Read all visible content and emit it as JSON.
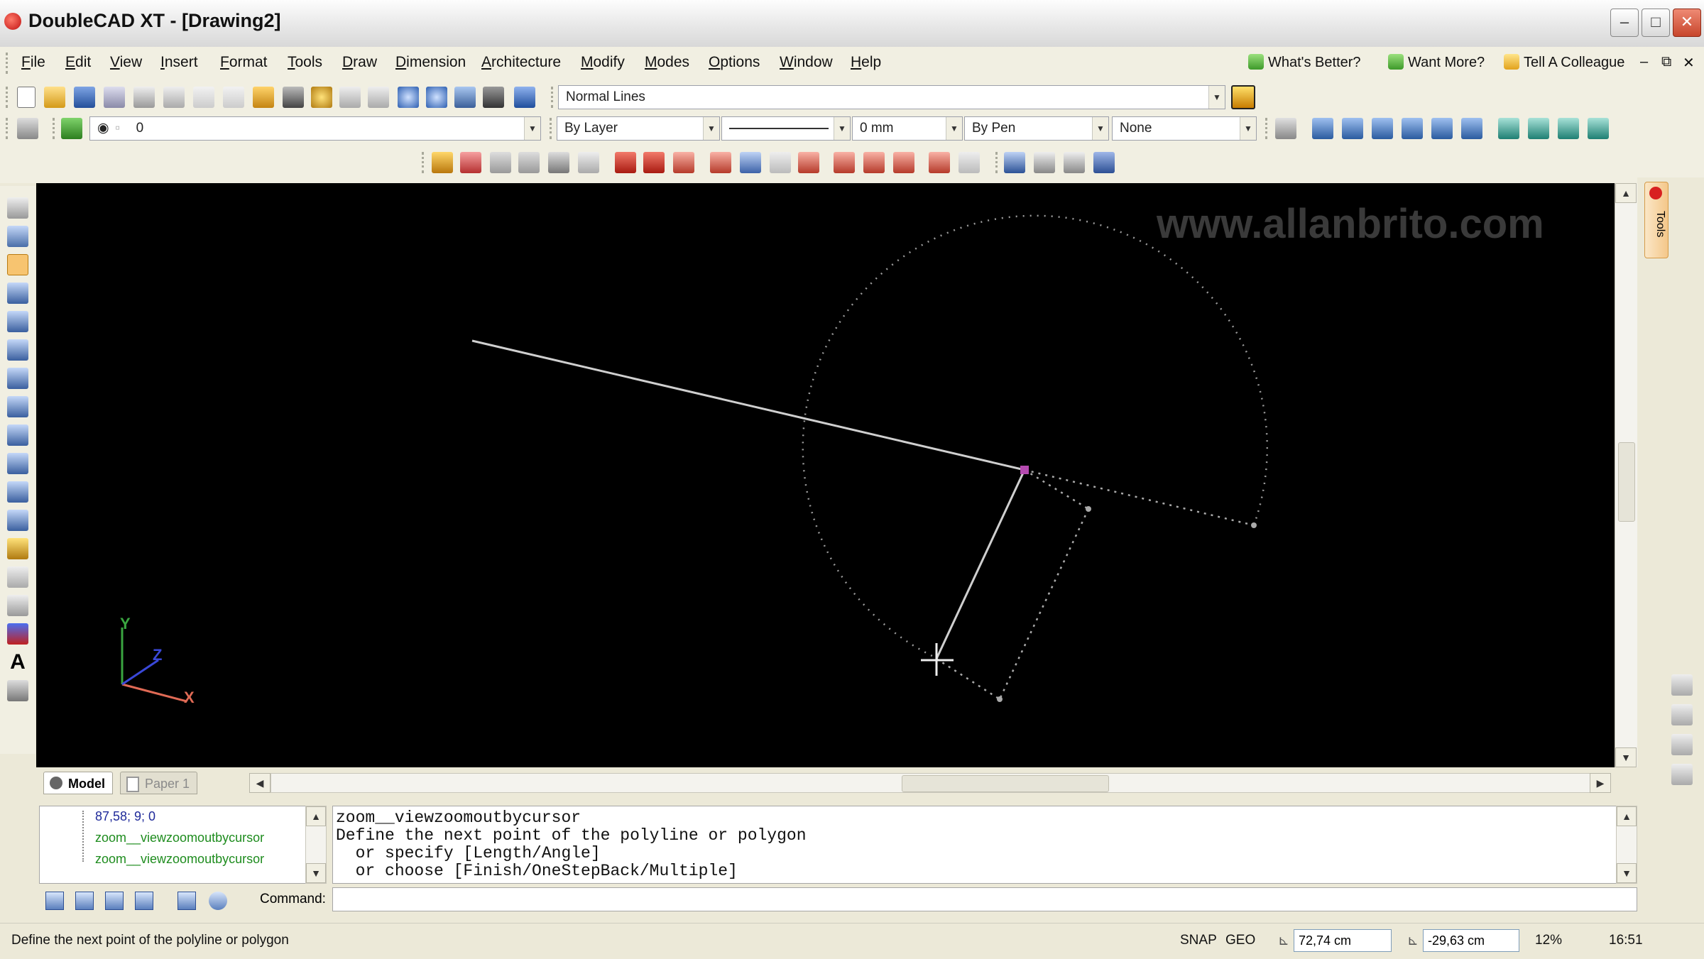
{
  "window": {
    "title": "DoubleCAD XT - [Drawing2]",
    "minimize": "–",
    "maximize": "□",
    "close": "✕"
  },
  "menu": {
    "items": [
      "File",
      "Edit",
      "View",
      "Insert",
      "Format",
      "Tools",
      "Draw",
      "Dimension",
      "Architecture",
      "Modify",
      "Modes",
      "Options",
      "Window",
      "Help"
    ],
    "links": [
      "What's Better?",
      "Want More?",
      "Tell A Colleague"
    ],
    "doc_controls": [
      "–",
      "⧉",
      "✕"
    ]
  },
  "toolbar": {
    "line_style": "Normal Lines",
    "layer": "0",
    "color": "By Layer",
    "line_width": "0 mm",
    "pen": "By Pen",
    "fill": "None"
  },
  "canvas": {
    "watermark": "www.allanbrito.com",
    "axis_x": "X",
    "axis_y": "Y",
    "axis_z": "Z"
  },
  "right_panel": {
    "tools_label": "Tools"
  },
  "tabs": {
    "model": "Model",
    "paper": "Paper 1"
  },
  "history": {
    "items": [
      "87,58; 9; 0",
      "zoom__viewzoomoutbycursor",
      "zoom__viewzoomoutbycursor"
    ]
  },
  "command_output": {
    "lines": [
      "zoom__viewzoomoutbycursor",
      "Define the next point of the polyline or polygon",
      "  or specify [Length/Angle]",
      "  or choose [Finish/OneStepBack/Multiple]"
    ]
  },
  "command": {
    "label": "Command:",
    "value": ""
  },
  "status": {
    "message": "Define the next point of the polyline or polygon",
    "snap": "SNAP",
    "geo": "GEO",
    "x_coord": "72,74 cm",
    "y_coord": "-29,63 cm",
    "zoom": "12%",
    "time": "16:51"
  },
  "colors": {
    "canvas_bg": "#000000",
    "chrome": "#ece9d8",
    "history_text_green": "#1e8c1e",
    "history_text_blue": "#1f2a9a"
  }
}
